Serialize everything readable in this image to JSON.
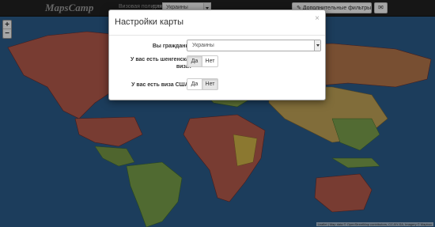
{
  "navbar": {
    "brand": "MapsCamp",
    "visa_policy_label": "Визовая политика",
    "for_label": "для",
    "country_select": "Украины",
    "filters_label": "✎ Дополнительные фильтры",
    "mail_icon": "envelope-icon"
  },
  "zoom": {
    "in_label": "+",
    "out_label": "−"
  },
  "modal": {
    "title": "Настройки карты",
    "close_label": "×",
    "citizen_label": "Вы гражданин",
    "citizen_value": "Украины",
    "schengen_label_1": "У вас есть шенгенская",
    "schengen_label_2": "виза?",
    "schengen_yes": "Да",
    "schengen_no": "Нет",
    "schengen_selected": "yes",
    "usa_label": "У вас есть виза США?",
    "usa_yes": "Да",
    "usa_no": "Нет",
    "usa_selected": "no"
  },
  "attribution": "Leaflet | Map data © OpenStreetMap contributors, CC-BY-SA, Imagery © Mapbox",
  "colors": {
    "ocean": "#2b5e8e",
    "visa_required": "#c0504d",
    "visa_free": "#4caf50",
    "visa_on_arrival": "#d6b84a"
  }
}
